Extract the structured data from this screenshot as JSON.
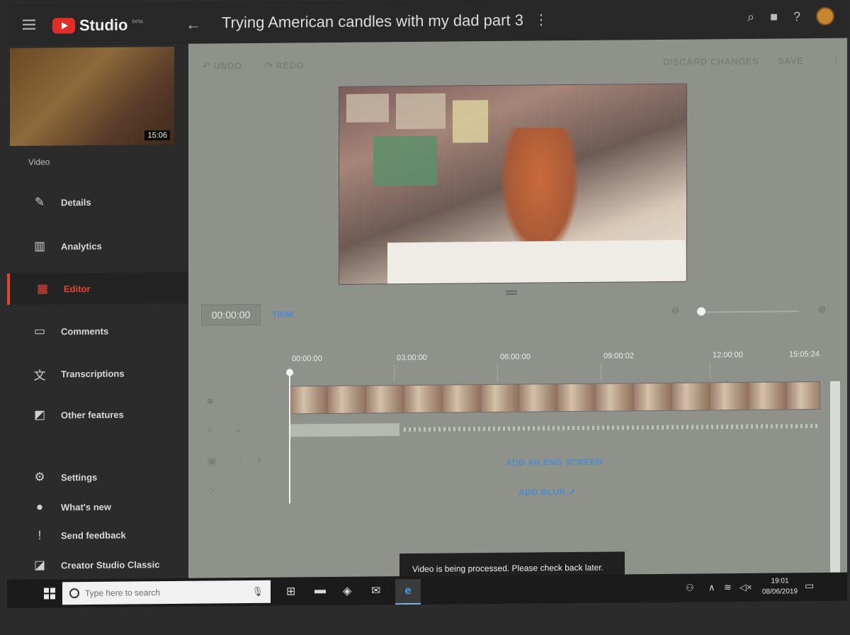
{
  "header": {
    "brand": "Studio",
    "brand_tag": "beta",
    "video_title": "Trying American candles with my dad part 3",
    "icons": [
      "search-icon",
      "create-video-icon",
      "help-icon",
      "account-avatar"
    ]
  },
  "sidebar": {
    "thumbnail_duration": "15:06",
    "section_label": "Video",
    "items": [
      {
        "label": "Details",
        "icon": "pencil-icon"
      },
      {
        "label": "Analytics",
        "icon": "analytics-icon"
      },
      {
        "label": "Editor",
        "icon": "editor-icon",
        "active": true
      },
      {
        "label": "Comments",
        "icon": "comments-icon"
      },
      {
        "label": "Transcriptions",
        "icon": "translate-icon"
      },
      {
        "label": "Other features",
        "icon": "other-features-icon"
      }
    ],
    "bottom_items": [
      {
        "label": "Settings",
        "icon": "gear-icon"
      },
      {
        "label": "What's new",
        "icon": "alert-icon"
      },
      {
        "label": "Send feedback",
        "icon": "feedback-icon"
      },
      {
        "label": "Creator Studio Classic",
        "icon": "classic-icon"
      }
    ]
  },
  "editor": {
    "undo_label": "UNDO",
    "redo_label": "REDO",
    "discard_label": "DISCARD CHANGES",
    "save_label": "SAVE",
    "timecode": "00:00:00",
    "trim_label": "TRIM",
    "ruler_ticks": [
      "00:00:00",
      "03:00:00",
      "06:00:00",
      "09:00:02",
      "12:00:00",
      "15:05:24"
    ],
    "add_end_screen_label": "ADD AN END SCREEN",
    "add_blur_label": "ADD BLUR"
  },
  "toast": {
    "message": "Video is being processed. Please check back later."
  },
  "taskbar": {
    "search_placeholder": "Type here to search",
    "time": "19:01",
    "date": "08/06/2019"
  },
  "accent_color": "#e4452c",
  "link_color": "#4f8ccf"
}
